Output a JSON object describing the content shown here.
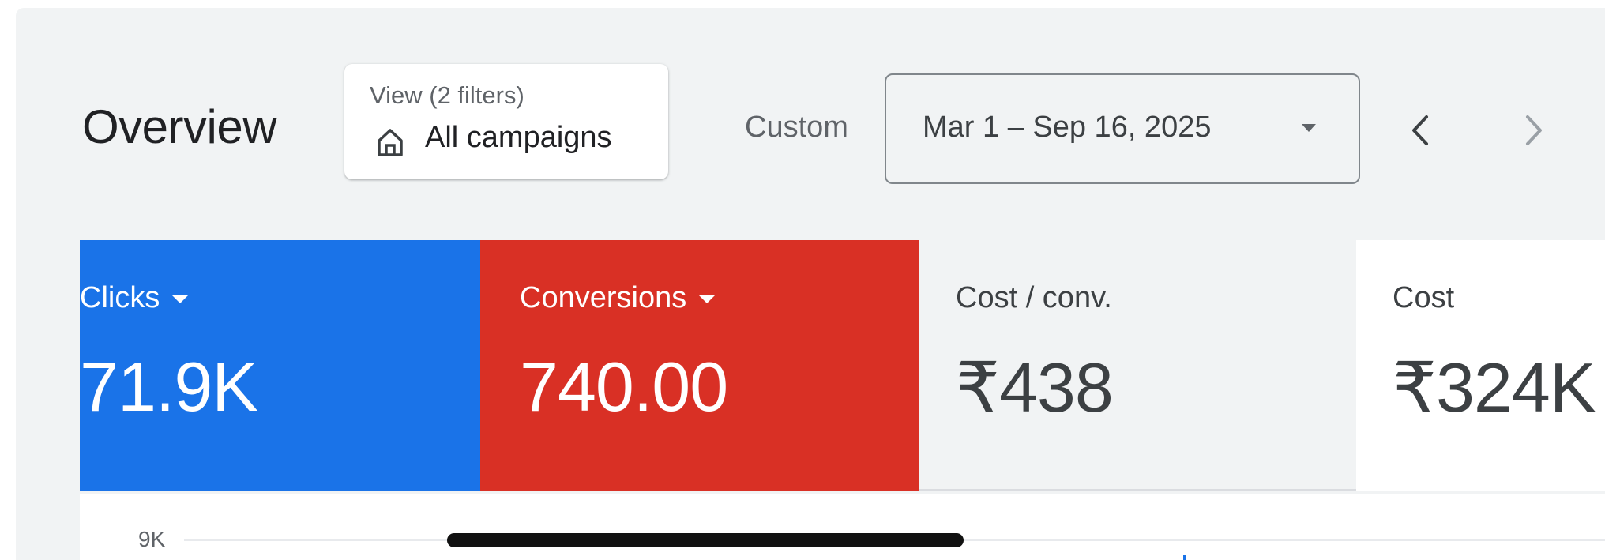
{
  "header": {
    "title": "Overview",
    "view_filter": {
      "caption": "View (2 filters)",
      "value": "All campaigns",
      "icon": "home-icon"
    },
    "date_range": {
      "preset_label": "Custom",
      "value": "Mar 1 – Sep 16, 2025"
    },
    "nav_icons": [
      "chevron-left-icon",
      "chevron-right-icon"
    ]
  },
  "scorecards": [
    {
      "label": "Clicks",
      "value": "71.9K",
      "color": "#1a73e8",
      "selected": true
    },
    {
      "label": "Conversions",
      "value": "740.00",
      "color": "#d93025",
      "selected": true
    },
    {
      "label": "Cost / conv.",
      "value": "₹438",
      "selected": false
    },
    {
      "label": "Cost",
      "value": "₹324K",
      "selected": false
    }
  ],
  "chart": {
    "y_ticks": [
      "9K"
    ]
  },
  "colors": {
    "primary_blue": "#1a73e8",
    "conversion_red": "#d93025",
    "panel_background": "#f1f3f4"
  }
}
